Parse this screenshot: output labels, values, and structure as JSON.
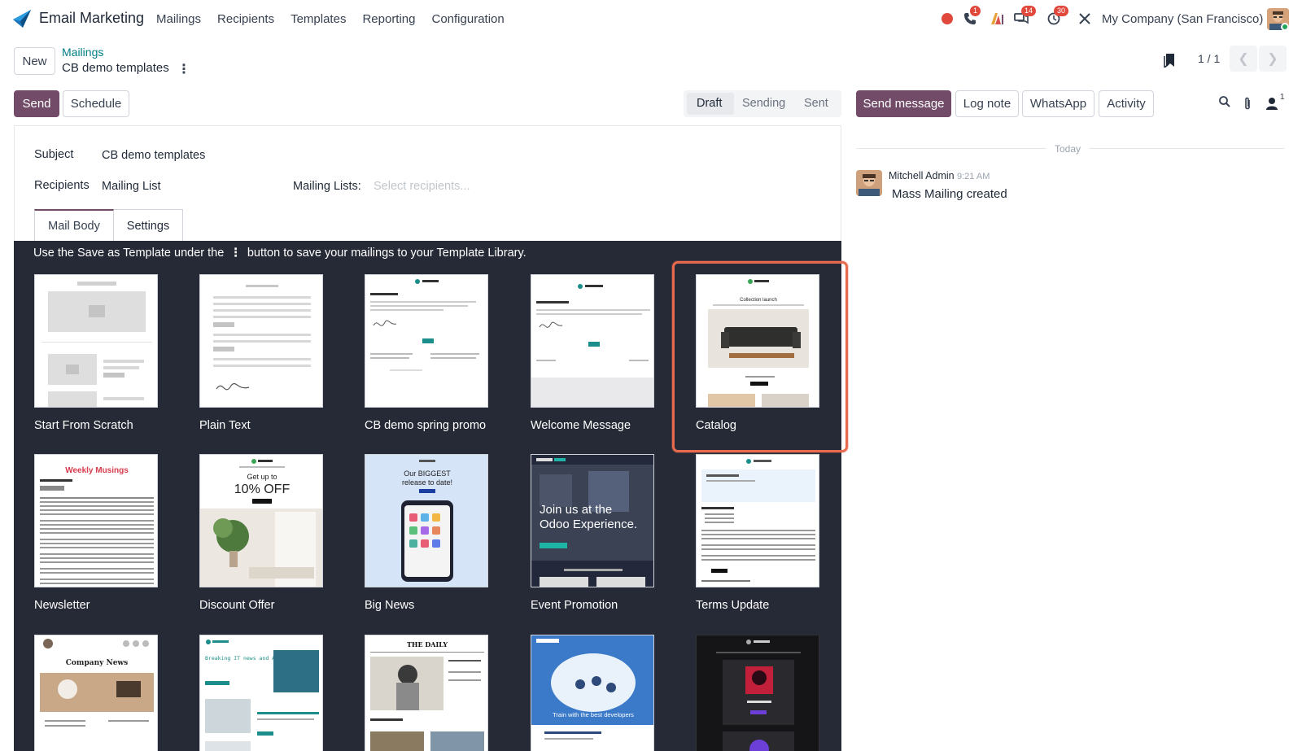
{
  "app": {
    "name": "Email Marketing",
    "menu": [
      "Mailings",
      "Recipients",
      "Templates",
      "Reporting",
      "Configuration"
    ]
  },
  "systray": {
    "phone_badge": "1",
    "messages_badge": "14",
    "activity_badge": "30",
    "company": "My Company (San Francisco)"
  },
  "control_panel": {
    "new_label": "New",
    "breadcrumb_parent": "Mailings",
    "breadcrumb_current": "CB demo templates",
    "pager": "1 / 1"
  },
  "actions": {
    "send": "Send",
    "schedule": "Schedule"
  },
  "status": {
    "draft": "Draft",
    "sending": "Sending",
    "sent": "Sent",
    "active": "Draft"
  },
  "form": {
    "subject_label": "Subject",
    "subject_value": "CB demo templates",
    "recipients_label": "Recipients",
    "recipients_value": "Mailing List",
    "mailing_lists_label": "Mailing Lists:",
    "mailing_lists_placeholder": "Select recipients..."
  },
  "tabs": {
    "mail_body": "Mail Body",
    "settings": "Settings"
  },
  "template_area": {
    "hint_before": "Use the Save as Template under the",
    "hint_after": "button to save your mailings to your Template Library.",
    "templates": [
      {
        "label": "Start From Scratch",
        "icon": "image-placeholder-icon"
      },
      {
        "label": "Plain Text",
        "icon": "text-lines-icon"
      },
      {
        "label": "CB demo spring promo",
        "icon": "email-preview-icon"
      },
      {
        "label": "Welcome Message",
        "icon": "email-preview-icon"
      },
      {
        "label": "Catalog",
        "icon": "sofa-image-icon",
        "selected": true
      },
      {
        "label": "Newsletter",
        "icon": "newspaper-icon"
      },
      {
        "label": "Discount Offer",
        "icon": "plant-image-icon"
      },
      {
        "label": "Big News",
        "icon": "phone-image-icon"
      },
      {
        "label": "Event Promotion",
        "icon": "event-image-icon"
      },
      {
        "label": "Terms Update",
        "icon": "document-icon"
      }
    ],
    "thumb_text": {
      "newsletter_title": "Weekly Musings",
      "discount_line1": "Get up to",
      "discount_line2": "10% OFF",
      "bignews_line1": "Our BIGGEST",
      "bignews_line2": "release to date!",
      "event_line1": "Join us at the",
      "event_line2": "Odoo Experience.",
      "company_news": "Company News",
      "daily": "THE DAILY",
      "train": "Train with the best developers",
      "catalog_title": "Collection launch",
      "breaking": "Breaking IT news and Analysis"
    }
  },
  "chatter": {
    "send_message": "Send message",
    "log_note": "Log note",
    "whatsapp": "WhatsApp",
    "activity": "Activity",
    "follower_count": "1",
    "today": "Today",
    "message": {
      "author": "Mitchell Admin",
      "time": "9:21 AM",
      "body": "Mass Mailing created"
    }
  },
  "colors": {
    "primary": "#714b67",
    "teal_link": "#017e84",
    "dark_area": "#262a36",
    "selected_border": "#e76a4e",
    "badge": "#e0483c"
  }
}
